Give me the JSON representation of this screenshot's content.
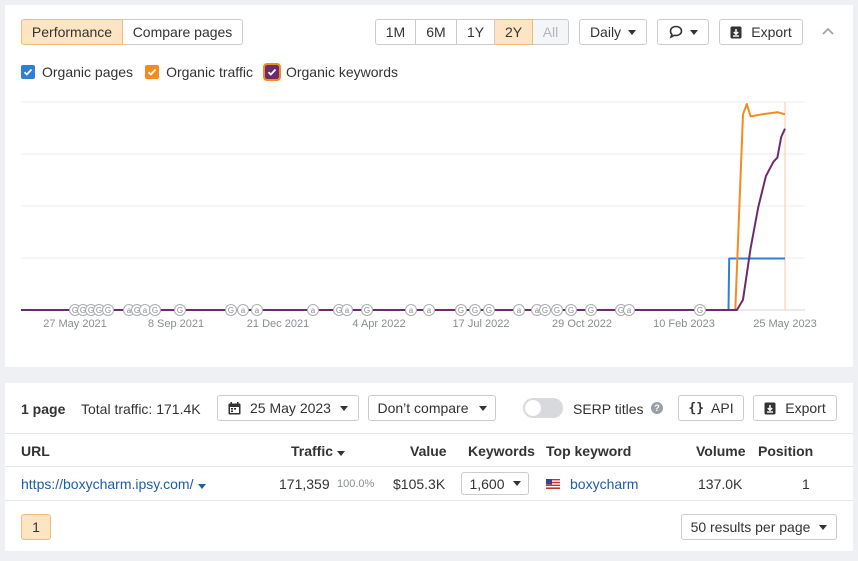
{
  "tabs": [
    {
      "label": "Performance",
      "active": true
    },
    {
      "label": "Compare pages",
      "active": false
    }
  ],
  "ranges": [
    {
      "label": "1M",
      "state": "normal"
    },
    {
      "label": "6M",
      "state": "normal"
    },
    {
      "label": "1Y",
      "state": "normal"
    },
    {
      "label": "2Y",
      "state": "active"
    },
    {
      "label": "All",
      "state": "disabled"
    }
  ],
  "interval": "Daily",
  "export_label": "Export",
  "legend": [
    {
      "label": "Organic pages",
      "color": "#2e7fd6"
    },
    {
      "label": "Organic traffic",
      "color": "#f58b1f"
    },
    {
      "label": "Organic keywords",
      "color": "#6b2c6e"
    }
  ],
  "chart_data": {
    "type": "line",
    "x_tick_labels": [
      "27 May 2021",
      "8 Sep 2021",
      "21 Dec 2021",
      "4 Apr 2022",
      "17 Jul 2022",
      "29 Oct 2022",
      "10 Feb 2023",
      "25 May 2023"
    ],
    "grid": true,
    "series": [
      {
        "name": "Organic pages",
        "color": "#2e7fd6",
        "points": [
          [
            0,
            0
          ],
          [
            0.926,
            0
          ],
          [
            0.927,
            0.25
          ],
          [
            1,
            0.25
          ]
        ]
      },
      {
        "name": "Organic traffic",
        "color": "#f58b1f",
        "points": [
          [
            0,
            0
          ],
          [
            0.935,
            0
          ],
          [
            0.945,
            0.95
          ],
          [
            0.95,
            1.0
          ],
          [
            0.955,
            0.94
          ],
          [
            0.97,
            0.95
          ],
          [
            0.99,
            0.96
          ],
          [
            1,
            0.95
          ]
        ]
      },
      {
        "name": "Organic keywords",
        "color": "#6b2c6e",
        "points": [
          [
            0,
            0
          ],
          [
            0.937,
            0
          ],
          [
            0.945,
            0.05
          ],
          [
            0.955,
            0.3
          ],
          [
            0.965,
            0.5
          ],
          [
            0.975,
            0.65
          ],
          [
            0.985,
            0.72
          ],
          [
            0.99,
            0.74
          ],
          [
            0.995,
            0.84
          ],
          [
            1,
            0.88
          ]
        ]
      }
    ],
    "annotations": [
      "G",
      "G",
      "G",
      "G",
      "G",
      "a",
      "G",
      "a",
      "G",
      "G",
      "G",
      "a",
      "a",
      "a",
      "G",
      "a",
      "G",
      "a",
      "a",
      "G",
      "G",
      "G",
      "a",
      "a",
      "G",
      "G",
      "G",
      "G",
      "G",
      "a",
      "G"
    ]
  },
  "summary": {
    "pages": "1 page",
    "traffic": "Total traffic: 171.4K",
    "date": "25 May 2023",
    "compare": "Don’t compare",
    "serp": "SERP titles",
    "api": "API",
    "export": "Export"
  },
  "table": {
    "headers": {
      "url": "URL",
      "traffic": "Traffic",
      "value": "Value",
      "keywords": "Keywords",
      "top": "Top keyword",
      "volume": "Volume",
      "position": "Position"
    },
    "rows": [
      {
        "url": "https://boxycharm.ipsy.com/",
        "traffic": "171,359",
        "share": "100.0%",
        "value": "$105.3K",
        "keywords": "1,600",
        "top": "boxycharm",
        "volume": "137.0K",
        "position": "1"
      }
    ]
  },
  "pager": {
    "page": "1",
    "per_page": "50 results per page"
  }
}
